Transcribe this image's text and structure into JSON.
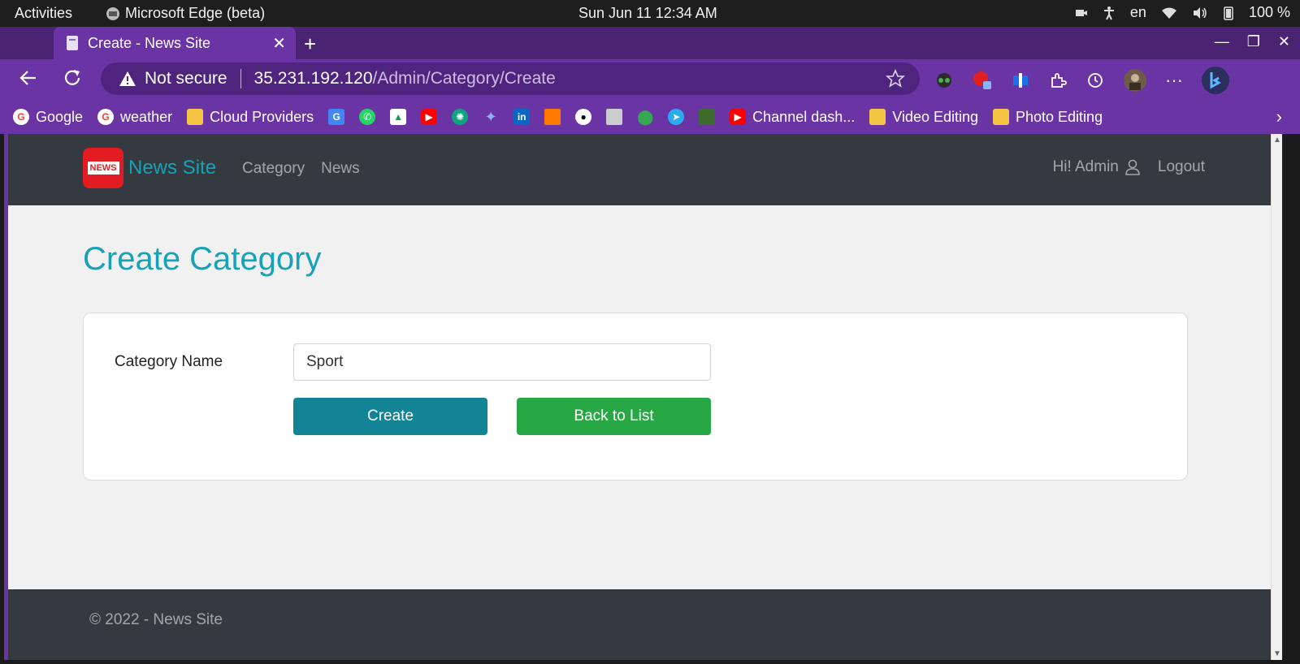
{
  "os": {
    "activities": "Activities",
    "app_name": "Microsoft Edge (beta)",
    "clock": "Sun Jun 11  12:34 AM",
    "lang": "en",
    "battery": "100 %"
  },
  "browser": {
    "tab_title": "Create - News Site",
    "not_secure": "Not secure",
    "url_host": "35.231.192.120",
    "url_path": "/Admin/Category/Create",
    "bookmarks": [
      {
        "label": "Google",
        "color": "#ea4335"
      },
      {
        "label": "weather",
        "color": "#ea4335"
      },
      {
        "label": "Cloud Providers",
        "color": "#f4c542"
      },
      {
        "label": "Channel dash...",
        "color": "#ff0000"
      },
      {
        "label": "Video Editing",
        "color": "#f4c542"
      },
      {
        "label": "Photo Editing",
        "color": "#f4c542"
      }
    ]
  },
  "site": {
    "brand": "News Site",
    "logo_text": "NEWS",
    "nav": [
      "Category",
      "News"
    ],
    "greeting": "Hi! Admin",
    "logout": "Logout"
  },
  "form": {
    "title": "Create Category",
    "label": "Category Name",
    "value": "Sport",
    "create_label": "Create",
    "back_label": "Back to List"
  },
  "footer": {
    "text": "© 2022 - News Site"
  },
  "colors": {
    "accent": "#17a2b8",
    "create_btn": "#138496",
    "back_btn": "#28a745",
    "chrome": "#6b34a5"
  }
}
